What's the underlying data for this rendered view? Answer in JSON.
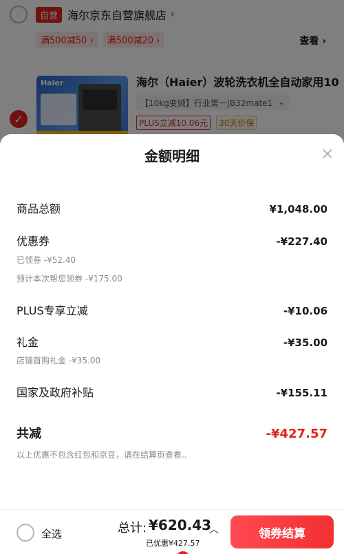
{
  "store": {
    "self_tag": "自营",
    "name": "海尔京东自营旗舰店",
    "chevron": "›",
    "promos": [
      "满500减50 ›",
      "满500减20 ›"
    ],
    "see_more": "查看 ›"
  },
  "product": {
    "brand_logo": "Haier",
    "title": "海尔（Haier）波轮洗衣机全自动家用10",
    "spec": "【10kg变频】行业第一|B32mate1",
    "spec_arrow": "⌄",
    "badge_plus": "PLUS立减10.06元",
    "badge_protect": "30天价保"
  },
  "sheet": {
    "title": "金额明细",
    "close": "×",
    "rows": [
      {
        "label": "商品总额",
        "amount": "¥1,048.00"
      },
      {
        "label": "优惠券",
        "amount": "-¥227.40"
      },
      {
        "label": "PLUS专享立减",
        "amount": "-¥10.06"
      },
      {
        "label": "礼金",
        "amount": "-¥35.00"
      },
      {
        "label": "国家及政府补贴",
        "amount": "-¥155.11"
      }
    ],
    "coupon_sub1": "已领券 -¥52.40",
    "coupon_sub2": "预计本次帮您领券 -¥175.00",
    "gift_sub": "店铺首购礼金 -¥35.00",
    "total_label": "共减",
    "total_amount": "-¥427.57",
    "note": "以上优惠不包含红包和京豆，请在结算页查看.."
  },
  "bottom_bar": {
    "select_all": "全选",
    "total_label": "总计:",
    "total_value": "¥620.43",
    "saved": "已优惠¥427.57",
    "chevron_up": "︿",
    "checkout": "领券结算"
  },
  "colors": {
    "accent": "#e1251b",
    "checkout_start": "#ff4a52",
    "checkout_end": "#f23030"
  }
}
